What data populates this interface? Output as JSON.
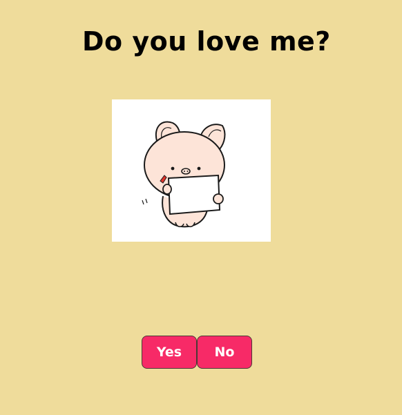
{
  "question": {
    "text": "Do you love me?"
  },
  "illustration": {
    "icon": "pig-holding-sign-icon"
  },
  "buttons": {
    "yes_label": "Yes",
    "no_label": "No"
  },
  "colors": {
    "background": "#efdc9b",
    "button_fill": "#f72a67",
    "button_text": "#ffffff"
  }
}
